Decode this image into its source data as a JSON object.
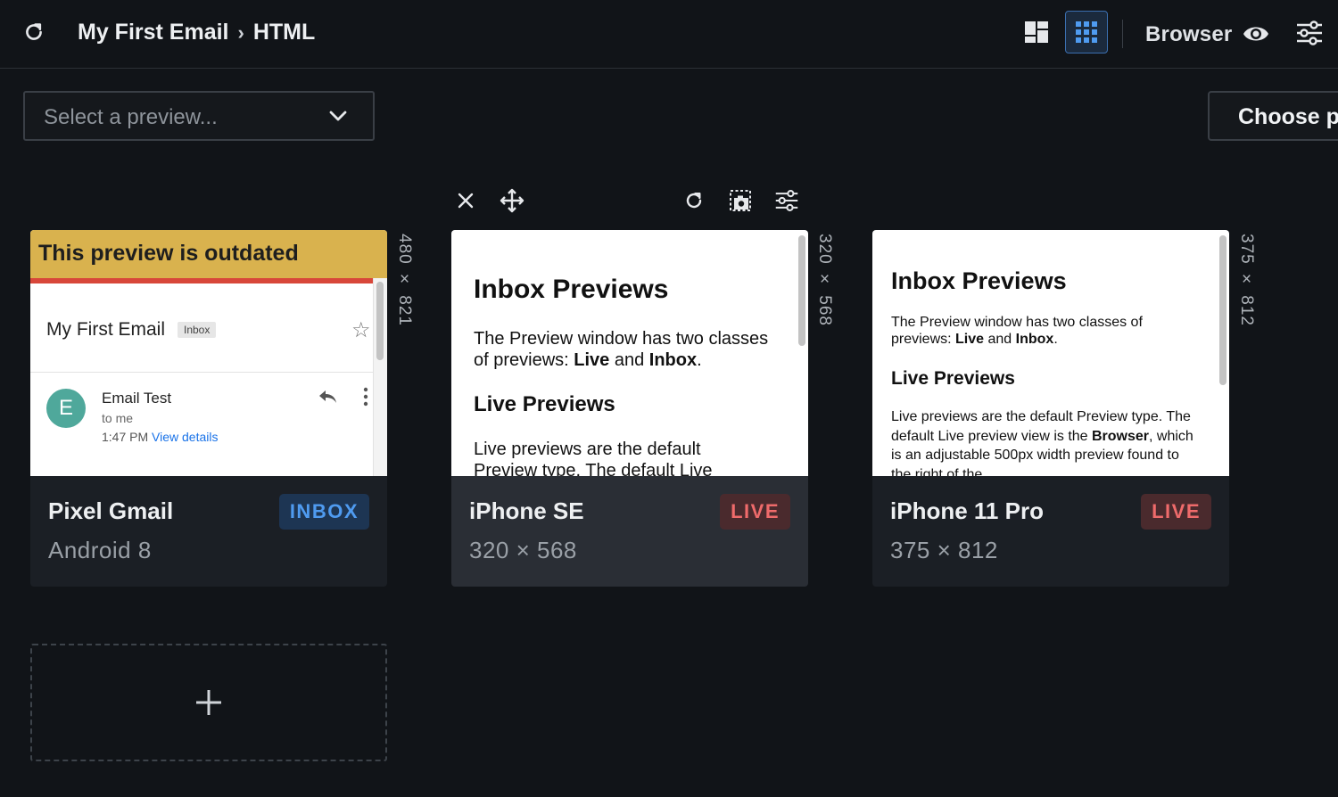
{
  "header": {
    "breadcrumb": [
      "My First Email",
      "HTML"
    ],
    "breadcrumb_separator": "›",
    "view_mode_label": "Browser"
  },
  "toolbar": {
    "select_placeholder": "Select a preview...",
    "choose_label": "Choose p"
  },
  "cards": [
    {
      "name": "Pixel Gmail",
      "subtitle": "Android 8",
      "badge": "INBOX",
      "dimension": "480 × 821",
      "screen": {
        "banner": "This preview is outdated",
        "subject": "My First Email",
        "tag": "Inbox",
        "avatar_letter": "E",
        "from": "Email Test",
        "to": "to me",
        "time": "1:47 PM",
        "link": "View details"
      }
    },
    {
      "name": "iPhone SE",
      "subtitle": "320 × 568",
      "badge": "LIVE",
      "dimension": "320 × 568",
      "screen": {
        "heading": "Inbox Previews",
        "intro_a": "The Preview window has two classes of previews: ",
        "intro_live": "Live",
        "intro_and": " and ",
        "intro_inbox": "Inbox",
        "intro_end": ".",
        "subheading": "Live Previews",
        "body": "Live previews are the default Preview type. The default Live"
      }
    },
    {
      "name": "iPhone 11 Pro",
      "subtitle": "375 × 812",
      "badge": "LIVE",
      "dimension": "375 × 812",
      "screen": {
        "heading": "Inbox Previews",
        "intro_a": "The Preview window has two classes of previews: ",
        "intro_live": "Live",
        "intro_and": " and ",
        "intro_inbox": "Inbox",
        "intro_end": ".",
        "subheading": "Live Previews",
        "body_a": "Live previews are the default Preview type. The default Live preview view is the ",
        "body_browser": "Browser",
        "body_b": ", which is an adjustable 500px width preview found to the right of the"
      }
    }
  ],
  "add_tile": {
    "symbol": "+"
  },
  "colors": {
    "background": "#111418",
    "accent_blue": "#4f9bf0",
    "live_red": "#ef6b6b",
    "outdated_banner": "#d9b24e"
  },
  "icons": [
    "refresh-icon",
    "dashboard-layout-icon",
    "grid-layout-icon",
    "eye-icon",
    "sliders-icon",
    "chevron-down-icon",
    "close-icon",
    "move-icon",
    "screenshot-icon",
    "plus-icon"
  ]
}
